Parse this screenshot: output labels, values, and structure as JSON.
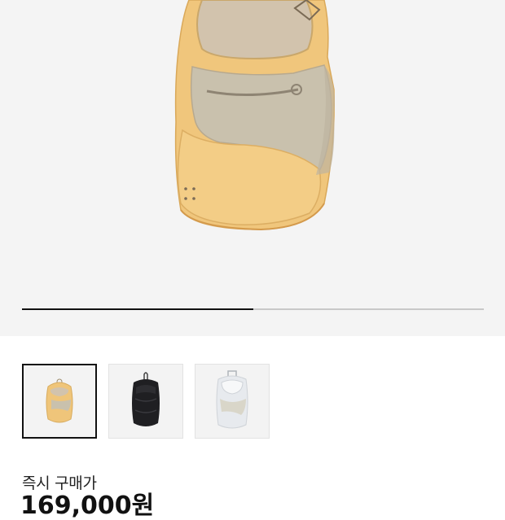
{
  "product": {
    "image_icon": "backpack-photo-yellow",
    "gallery_progress": 0.5
  },
  "thumbnails": [
    {
      "name": "thumbnail-yellow",
      "color": "#efc57a",
      "selected": true
    },
    {
      "name": "thumbnail-black",
      "color": "#1f1f22",
      "selected": false
    },
    {
      "name": "thumbnail-white",
      "color": "#e7eaee",
      "selected": false
    }
  ],
  "pricing": {
    "instant_buy_label": "즉시 구매가",
    "instant_buy_price": "169,000원"
  },
  "colors": {
    "accent_dark": "#111111",
    "bag_yellow": "#efc57a",
    "mesh_beige": "#cbbfa8"
  }
}
